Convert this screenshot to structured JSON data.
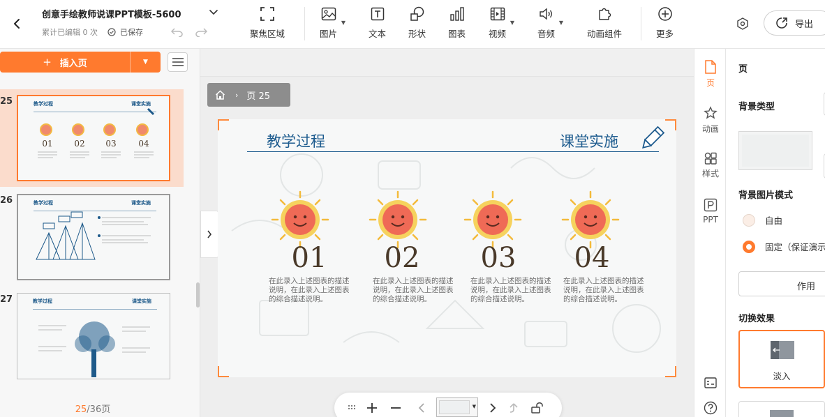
{
  "header": {
    "title": "创意手绘教师说课PPT模板-5600",
    "edit_count": "累计已编辑 0 次",
    "saved_status": "已保存",
    "export_label": "导出"
  },
  "toolbar": {
    "focus": "聚焦区域",
    "image": "图片",
    "text": "文本",
    "shape": "形状",
    "chart": "图表",
    "video": "视频",
    "audio": "音频",
    "animation_widget": "动画组件",
    "more": "更多"
  },
  "left_panel": {
    "insert_page": "插入页",
    "slides": [
      {
        "num": "25",
        "title_l": "教学过程",
        "title_r": "课堂实施"
      },
      {
        "num": "26",
        "title_l": "教学过程",
        "title_r": "课堂实施"
      },
      {
        "num": "27",
        "title_l": "教学过程",
        "title_r": "课堂实施"
      }
    ],
    "current_page": "25",
    "total_pages": "/36页"
  },
  "canvas": {
    "breadcrumb_page": "页 25",
    "slide": {
      "title_left": "教学过程",
      "title_right": "课堂实施",
      "items": [
        {
          "num": "01",
          "desc": "在此录入上述图表的描述说明，在此录入上述图表的综合描述说明。"
        },
        {
          "num": "02",
          "desc": "在此录入上述图表的描述说明，在此录入上述图表的综合描述说明。"
        },
        {
          "num": "03",
          "desc": "在此录入上述图表的描述说明，在此录入上述图表的综合描述说明。"
        },
        {
          "num": "04",
          "desc": "在此录入上述图表的描述说明，在此录入上述图表的综合描述说明。"
        }
      ]
    }
  },
  "right_tabs": {
    "page": "页",
    "animation": "动画",
    "style": "样式",
    "ppt": "PPT"
  },
  "properties": {
    "heading": "页",
    "bg_type_label": "背景类型",
    "bg_mode_label": "背景图片模式",
    "mode_free": "自由",
    "mode_fixed": "固定（保证演示",
    "apply_label": "作用",
    "transition_label": "切换效果",
    "transition_selected": "淡入"
  },
  "colors": {
    "accent": "#ff7a2e",
    "slide_blue": "#1d5b8e"
  }
}
